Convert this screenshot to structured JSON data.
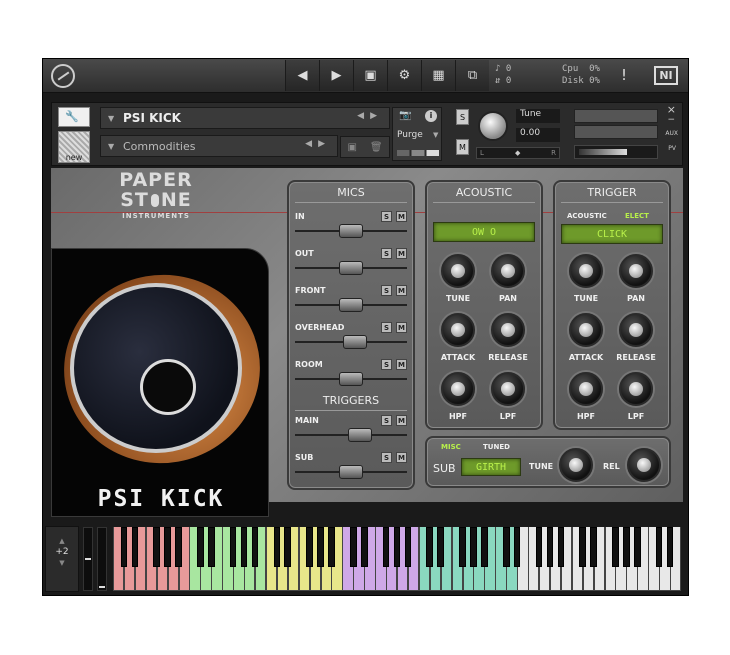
{
  "toolbar": {
    "midi_in": "0",
    "midi_out": "0",
    "cpu_label": "Cpu",
    "cpu_value": "0%",
    "disk_label": "Disk",
    "disk_value": "0%",
    "warning": "!",
    "ni_logo": "NI"
  },
  "header": {
    "instrument_name": "PSI KICK",
    "library_name": "Commodities",
    "new_label": "new",
    "purge_label": "Purge",
    "solo": "S",
    "mute": "M",
    "tune_label": "Tune",
    "tune_value": "0.00",
    "pan_left": "L",
    "pan_right": "R",
    "aux_label": "AUX",
    "pv_label": "PV",
    "close": "×",
    "minus": "−"
  },
  "brand": {
    "line1": "PAPER",
    "line2a": "ST",
    "line2b": "NE",
    "line3": "INSTRUMENTS"
  },
  "drum_title": "PSI KICK",
  "mics": {
    "title": "MICS",
    "channels": [
      {
        "label": "IN",
        "level": 0.5
      },
      {
        "label": "OUT",
        "level": 0.5
      },
      {
        "label": "FRONT",
        "level": 0.5
      },
      {
        "label": "OVERHEAD",
        "level": 0.55
      },
      {
        "label": "ROOM",
        "level": 0.5
      }
    ],
    "triggers_title": "TRIGGERS",
    "triggers": [
      {
        "label": "MAIN",
        "level": 0.6
      },
      {
        "label": "SUB",
        "level": 0.5
      }
    ],
    "s": "S",
    "m": "M"
  },
  "acoustic": {
    "title": "ACOUSTIC",
    "display": "OW O",
    "knobs": [
      "TUNE",
      "PAN",
      "ATTACK",
      "RELEASE",
      "HPF",
      "LPF"
    ]
  },
  "trigger": {
    "title": "TRIGGER",
    "tab_acoustic": "ACOUSTIC",
    "tab_elect": "ELECT",
    "display": "CLICK",
    "knobs": [
      "TUNE",
      "PAN",
      "ATTACK",
      "RELEASE",
      "HPF",
      "LPF"
    ]
  },
  "sub": {
    "tab_misc": "MISC",
    "tab_tuned": "TUNED",
    "label": "SUB",
    "display": "GIRTH",
    "tune_label": "TUNE",
    "rel_label": "REL"
  },
  "keyboard": {
    "octave": "+2"
  },
  "colors": {
    "lcd_text": "#b8f04a",
    "zone_red": "#e89a9a",
    "zone_green": "#a8e6a0",
    "zone_yellow": "#e8e68a",
    "zone_purple": "#cfa8e8",
    "zone_teal": "#8ad8c0",
    "zone_white": "#e8e8e8"
  }
}
